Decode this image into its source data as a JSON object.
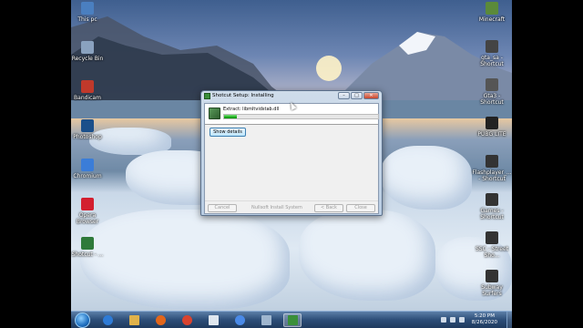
{
  "desktop": {
    "left_icons": [
      {
        "label": "This pc",
        "icon": "computer-icon",
        "color": "#4a7fc0"
      },
      {
        "label": "Recycle Bin",
        "icon": "recycle-bin-icon",
        "color": "#8aa2bf"
      },
      {
        "label": "Bandicam",
        "icon": "bandicam-icon",
        "color": "#c0392b"
      },
      {
        "label": "Photoshop",
        "icon": "photoshop-icon",
        "color": "#1b4f8a"
      },
      {
        "label": "Chromium",
        "icon": "chromium-icon",
        "color": "#3b7dd8"
      },
      {
        "label": "Opera Browser",
        "icon": "opera-icon",
        "color": "#d31f2f"
      },
      {
        "label": "Shotcut - ...",
        "icon": "shotcut-icon",
        "color": "#2f7a3a"
      }
    ],
    "right_icons": [
      {
        "label": "Minecraft",
        "icon": "minecraft-icon",
        "color": "#5b8a3a"
      },
      {
        "label": "gta_sa - Shortcut",
        "icon": "gta-sa-icon",
        "color": "#444444"
      },
      {
        "label": "Gta3 - Shortcut",
        "icon": "gta3-icon",
        "color": "#555555"
      },
      {
        "label": "PUBG LITE",
        "icon": "pubg-icon",
        "color": "#222222"
      },
      {
        "label": "Flashplayer_... - Shortcut",
        "icon": "flashplayer-icon",
        "color": "#333333"
      },
      {
        "label": "Games - Shortcut",
        "icon": "games-icon",
        "color": "#333333"
      },
      {
        "label": "SSC - Street Sho...",
        "icon": "ssc-icon",
        "color": "#333333"
      },
      {
        "label": "Subway Surfers",
        "icon": "subway-surfers-icon",
        "color": "#333333"
      }
    ]
  },
  "dialog": {
    "title": "Shotcut Setup: Installing",
    "status": "Extract: libmltvidstab.dll",
    "progress_fraction": 0.08,
    "show_details_label": "Show details",
    "buttons": {
      "cancel": "Cancel",
      "back": "< Back",
      "close": "Close"
    },
    "brand": "Nullsoft Install System",
    "caption": {
      "minimize": "–",
      "maximize": "□",
      "close": "✕"
    }
  },
  "taskbar": {
    "pinned": [
      {
        "name": "ie",
        "icon": "internet-explorer-icon",
        "color": "#2e7bd6",
        "active": false
      },
      {
        "name": "explorer",
        "icon": "folder-icon",
        "color": "#e0b24a",
        "active": false
      },
      {
        "name": "firefox",
        "icon": "firefox-icon",
        "color": "#e2661b",
        "active": false
      },
      {
        "name": "chrome",
        "icon": "chrome-icon",
        "color": "#d9432f",
        "active": false
      },
      {
        "name": "notepad",
        "icon": "notepad-icon",
        "color": "#dfe7ef",
        "active": false
      },
      {
        "name": "chromium",
        "icon": "chromium-icon",
        "color": "#4a8ae8",
        "active": false
      },
      {
        "name": "monitor",
        "icon": "monitor-icon",
        "color": "#9fb6cf",
        "active": false
      },
      {
        "name": "shotcut-setup",
        "icon": "installer-icon",
        "color": "#3a8f3a",
        "active": true
      }
    ],
    "time": "5:20 PM",
    "date": "8/26/2020"
  }
}
